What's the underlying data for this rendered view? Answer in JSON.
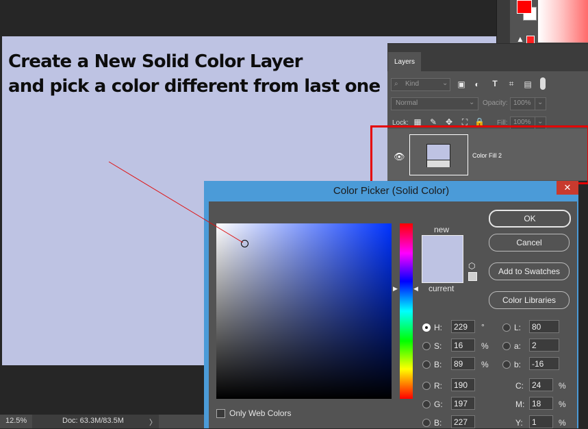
{
  "annotation": {
    "line1": "Create a New Solid Color Layer",
    "line2": "and pick a color different from last one"
  },
  "status_bar": {
    "zoom": "12.5%",
    "doc": "Doc: 63.3M/83.5M",
    "chevron": "〉"
  },
  "layers": {
    "tab_label": "Layers",
    "kind_label": "Kind",
    "blend_mode": "Normal",
    "opacity_label": "Opacity:",
    "opacity_value": "100%",
    "lock_label": "Lock:",
    "fill_label": "Fill:",
    "fill_value": "100%",
    "layer_name": "Color Fill 2"
  },
  "dialog": {
    "title": "Color Picker (Solid Color)",
    "close": "✕",
    "new_label": "new",
    "current_label": "current",
    "buttons": {
      "ok": "OK",
      "cancel": "Cancel",
      "add_swatches": "Add to Swatches",
      "color_libraries": "Color Libraries"
    },
    "hsb": [
      {
        "label": "H:",
        "value": "229",
        "unit": "°"
      },
      {
        "label": "S:",
        "value": "16",
        "unit": "%"
      },
      {
        "label": "B:",
        "value": "89",
        "unit": "%"
      }
    ],
    "rgb": [
      {
        "label": "R:",
        "value": "190"
      },
      {
        "label": "G:",
        "value": "197"
      },
      {
        "label": "B:",
        "value": "227"
      }
    ],
    "lab": [
      {
        "label": "L:",
        "value": "80"
      },
      {
        "label": "a:",
        "value": "2"
      },
      {
        "label": "b:",
        "value": "-16"
      }
    ],
    "cmyk": [
      {
        "label": "C:",
        "value": "24",
        "unit": "%"
      },
      {
        "label": "M:",
        "value": "18",
        "unit": "%"
      },
      {
        "label": "Y:",
        "value": "1",
        "unit": "%"
      }
    ],
    "only_web_colors": "Only Web Colors"
  },
  "colors": {
    "selected": "#bec3e3",
    "foreground": "#ff0000",
    "highlight": "#e50000"
  }
}
